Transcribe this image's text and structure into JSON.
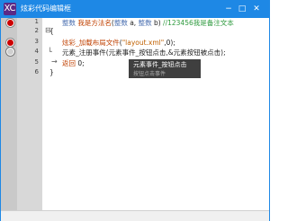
{
  "window": {
    "title": "炫彩代码编辑框",
    "icon_text": "XC",
    "buttons": {
      "minimize": "−",
      "maximize": "□",
      "close": "✕"
    }
  },
  "editor": {
    "line_numbers": [
      "1",
      "2",
      "3",
      "4",
      "5",
      "6"
    ],
    "breakpoints": [
      {
        "line": "1",
        "type": "filled"
      },
      {
        "line": "3",
        "type": "filled"
      },
      {
        "line": "4",
        "type": "hollow"
      }
    ],
    "code": {
      "l1": {
        "kw1": "整数",
        "fn": "我是方法名",
        "p1": "(",
        "kw2": "整数",
        "a": " a, ",
        "kw3": "整数",
        "b": " b) ",
        "comment": "//123456我是备注文本"
      },
      "l2": {
        "text": "{"
      },
      "l3": {
        "fn": "炫彩_加载布局文件",
        "p1": "(",
        "str": "\"layout.xml\"",
        "p2": ",0);"
      },
      "l4": {
        "text": "元素_注册事件(元素事件_按钮点击,&元素按钮被点击);"
      },
      "l5": {
        "kw": "返回",
        "rest": " 0;"
      },
      "l6": {
        "text": "}"
      }
    },
    "fold_markers": {
      "line2": "⊟",
      "line4": "└",
      "arrow": "→"
    },
    "tooltip": {
      "title": "元素事件_按钮点击",
      "subtitle": "按钮点击事件"
    }
  }
}
